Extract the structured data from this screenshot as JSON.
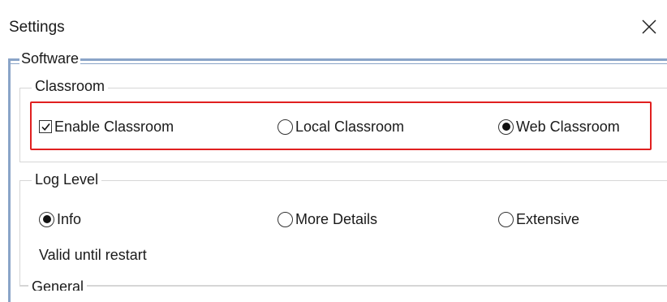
{
  "window": {
    "title": "Settings",
    "close_icon": "close-icon"
  },
  "software": {
    "label": "Software",
    "classroom": {
      "title": "Classroom",
      "options": [
        {
          "label": "Enable Classroom",
          "type": "checkbox",
          "checked": true
        },
        {
          "label": "Local Classroom",
          "type": "radio",
          "checked": false
        },
        {
          "label": "Web Classroom",
          "type": "radio",
          "checked": true
        }
      ]
    },
    "log_level": {
      "title": "Log Level",
      "options": [
        {
          "label": "Info",
          "type": "radio",
          "checked": true
        },
        {
          "label": "More Details",
          "type": "radio",
          "checked": false
        },
        {
          "label": "Extensive",
          "type": "radio",
          "checked": false
        }
      ],
      "note": "Valid until restart"
    },
    "next_group_partial": "General"
  },
  "colors": {
    "highlight": "#e02020",
    "frame": "#8aa4c8"
  }
}
